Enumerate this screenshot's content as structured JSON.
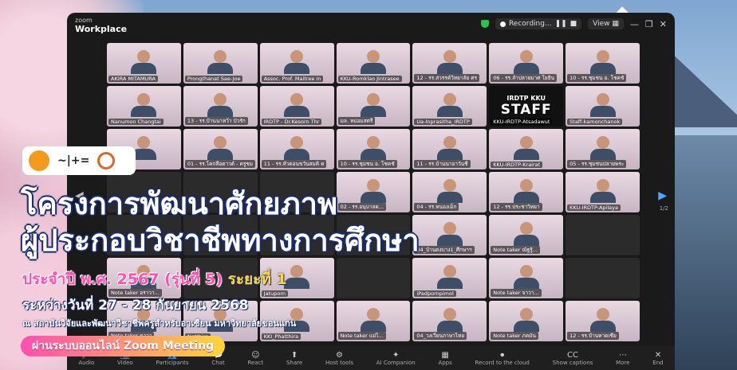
{
  "window": {
    "brand_top": "zoom",
    "brand_bottom": "Workplace",
    "recording": "Recording...",
    "view": "View"
  },
  "tiles": [
    {
      "name": "AKIRA MITAMURA"
    },
    {
      "name": "Prongthanat Sae-Joe"
    },
    {
      "name": "Assoc. Prof. Maitree In"
    },
    {
      "name": "KKU-Romklao Jintrasee"
    },
    {
      "name": "12 - รร.สวรรค์วิทยาลัย ศร"
    },
    {
      "name": "06 - รร.ลำปลายมาศ โยธิน"
    },
    {
      "name": "10 - รร.ชุมชน อ. โชคชั"
    },
    {
      "name": "Nanumon Changtai"
    },
    {
      "name": "13 - รร.บ้านนาหว้า บัวรัก"
    },
    {
      "name": "IRDTP - Dr.Kesorn Thr"
    },
    {
      "name": "มล. หม่อมสตรี"
    },
    {
      "name": "Ua-Inprasitha_IRDTP"
    },
    {
      "name": "KKU-IRDTP-Atsadawut",
      "staff": true
    },
    {
      "name": "Staff-kamonchanok"
    },
    {
      "name": ""
    },
    {
      "name": "01 - รร.โคกสีอดาวต์ - ครูชม"
    },
    {
      "name": "11 - รร.หัวดอนขวันสมคิ ด"
    },
    {
      "name": "10 - รร.ชุมชน อ. โชคชั"
    },
    {
      "name": "11 - รร.บ้านนาอาวันชี"
    },
    {
      "name": "KKU-IRDTP-Krairat"
    },
    {
      "name": "05 - รร.ชุมชนปลายพระ"
    },
    {
      "name": ""
    },
    {
      "name": ""
    },
    {
      "name": ""
    },
    {
      "name": "02 - รร.อนุบาลด..."
    },
    {
      "name": "04 - รร.หนองเม็ก"
    },
    {
      "name": "12 - รร.ประชาวิทยา"
    },
    {
      "name": "KKU-IRDTP-Apilaya"
    },
    {
      "name": ""
    },
    {
      "name": ""
    },
    {
      "name": ""
    },
    {
      "name": ""
    },
    {
      "name": "04_บ้านดงบาง1_ศึกษาฯ"
    },
    {
      "name": "Note taker ณัฐรู้..."
    },
    {
      "name": ""
    },
    {
      "name": "Note taker อราวา..."
    },
    {
      "name": ""
    },
    {
      "name": "Jatuporn"
    },
    {
      "name": ""
    },
    {
      "name": "iPadpornpimol"
    },
    {
      "name": "Note taker จาวา..."
    },
    {
      "name": ""
    },
    {
      "name": "Note taker ดาวา"
    },
    {
      "name": "Natthira"
    },
    {
      "name": "KKI_Phatthira"
    },
    {
      "name": "Note taker แม่ไ..."
    },
    {
      "name": "04_วงเวียนภาษาไทย"
    },
    {
      "name": "Note taker ภคมัน"
    },
    {
      "name": "12 - รร.บ้านหาดเชีย"
    }
  ],
  "staff_tile": {
    "line1": "IRDTP KKU",
    "line2": "STAFF"
  },
  "pager": "1/2",
  "toolbar": [
    "Audio",
    "Video",
    "Participants",
    "Chat",
    "React",
    "Share",
    "Host tools",
    "AI Companion",
    "Apps",
    "Record to the cloud",
    "Show captions",
    "More",
    "End"
  ],
  "overlay": {
    "logo_mark": "~|+=",
    "title1": "โครงการพัฒนาศักยภาพ",
    "title2": "ผู้ประกอบวิชาชีพทางการศึกษา",
    "year_line": "ประจำปี พ.ศ. 2567 (รุ่นที่ 5)",
    "round": "ระยะที่ 1",
    "date_line": "ระหว่างวันที่ 27 - 28 กันยายน 2568",
    "venue_line": "ณ สถาบันวิจัยและพัฒนาวิชาชีพครูสำหรับอาเซียน มหาวิทยาลัยขอนแก่น",
    "platform": "ผ่านระบบออนไลน์ Zoom Meeting"
  }
}
